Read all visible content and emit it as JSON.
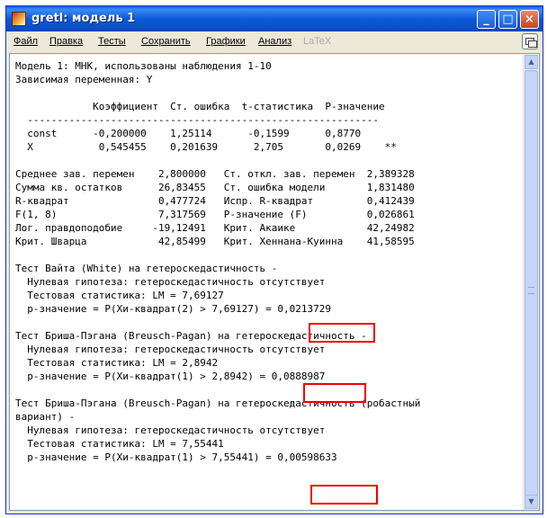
{
  "window": {
    "title": "gretl: модель 1"
  },
  "title_buttons": [
    "_",
    "□",
    "×"
  ],
  "menu": [
    "Файл",
    "Правка",
    "Тесты",
    "Сохранить",
    "Графики",
    "Анализ",
    "LaTeX"
  ],
  "output_lines": [
    "Модель 1: МНК, использованы наблюдения 1-10",
    "Зависимая переменная: Y",
    "",
    "             Коэффициент  Ст. ошибка  t-статистика  P-значение",
    "  -----------------------------------------------------------",
    "  const      -0,200000    1,25114      -0,1599      0,8770",
    "  X           0,545455    0,201639      2,705       0,0269    **",
    "",
    "Среднее зав. перемен    2,800000   Ст. откл. зав. перемен  2,389328",
    "Сумма кв. остатков      26,83455   Ст. ошибка модели       1,831480",
    "R-квадрат               0,477724   Испр. R-квадрат         0,412439",
    "F(1, 8)                 7,317569   Р-значение (F)          0,026861",
    "Лог. правдоподобие     -19,12491   Крит. Акаике            42,24982",
    "Крит. Шварца            42,85499   Крит. Хеннана-Куинна    41,58595",
    "",
    "Тест Вайта (White) на гетероскедастичность -",
    "  Нулевая гипотеза: гетероскедастичность отсутствует",
    "  Тестовая статистика: LM = 7,69127",
    "  p-значение = P(Хи-квадрат(2) > 7,69127) = 0,0213729",
    "",
    "Тест Бриша-Пэгана (Breusch-Pagan) на гетероскедастичность -",
    "  Нулевая гипотеза: гетероскедастичность отсутствует",
    "  Тестовая статистика: LM = 2,8942",
    "  p-значение = P(Хи-квадрат(1) > 2,8942) = 0,0888987",
    "",
    "Тест Бриша-Пэгана (Breusch-Pagan) на гетероскедастичность (робастный",
    "вариант) -",
    "  Нулевая гипотеза: гетероскедастичность отсутствует",
    "  Тестовая статистика: LM = 7,55441",
    "  p-значение = P(Хи-квадрат(1) > 7,55441) = 0,00598633"
  ],
  "highlight_color": "#ee0000"
}
